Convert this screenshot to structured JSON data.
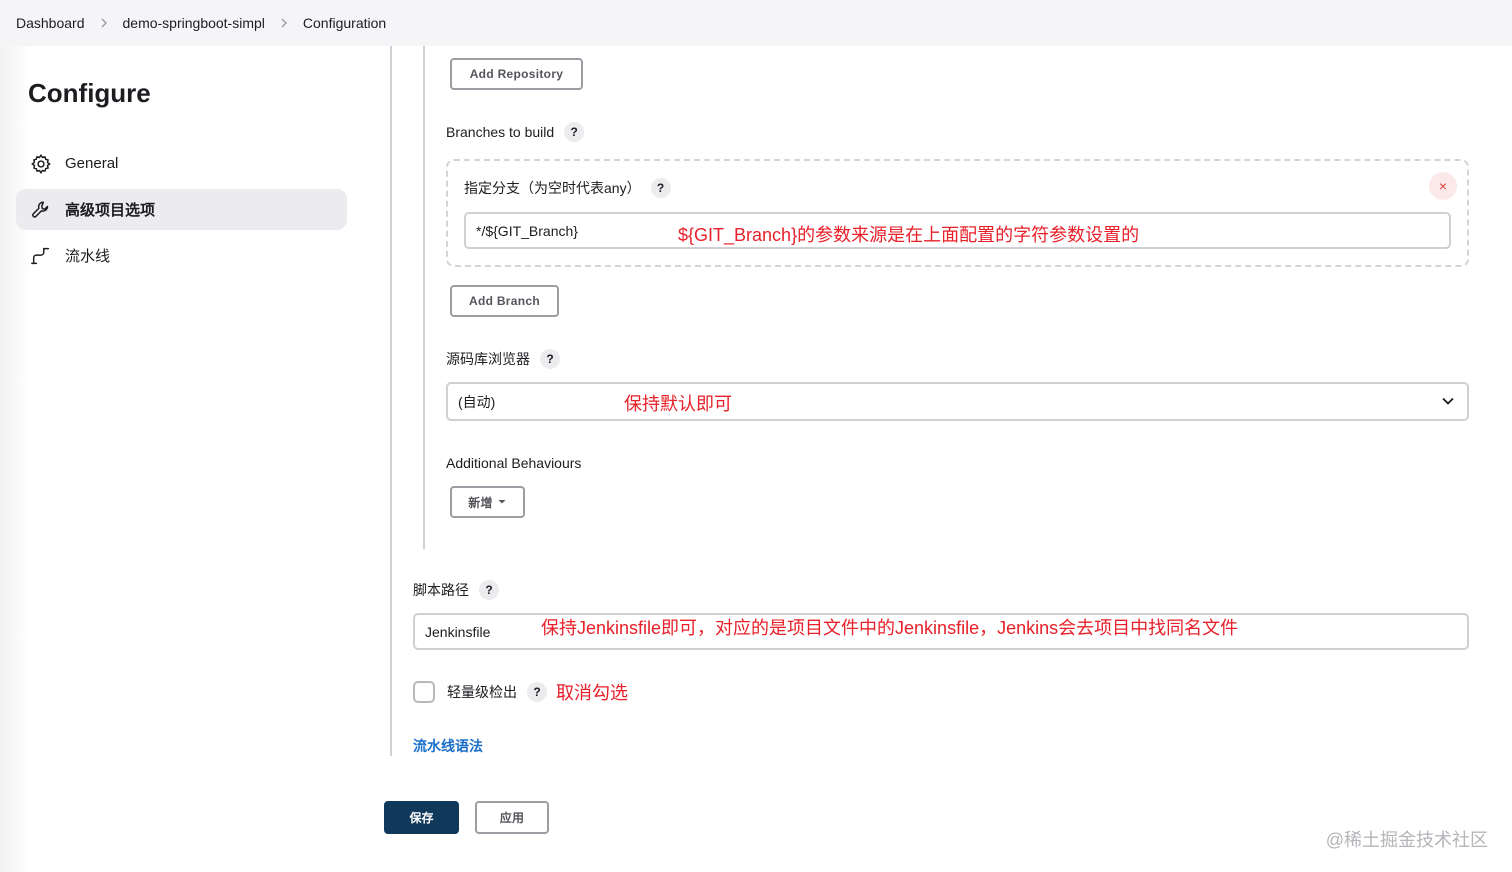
{
  "breadcrumb": {
    "items": [
      "Dashboard",
      "demo-springboot-simpl",
      "Configuration"
    ],
    "separator": ">"
  },
  "sidebar": {
    "title": "Configure",
    "items": [
      {
        "label": "General",
        "icon": "gear-icon",
        "active": false
      },
      {
        "label": "高级项目选项",
        "icon": "wrench-icon",
        "active": true
      },
      {
        "label": "流水线",
        "icon": "pipeline-icon",
        "active": false
      }
    ]
  },
  "scm": {
    "add_repository_label": "Add Repository",
    "branches_label": "Branches to build",
    "branch_spec_label": "指定分支（为空时代表any）",
    "branch_value": "*/${GIT_Branch}",
    "branch_annotation": "${GIT_Branch}的参数来源是在上面配置的字符参数设置的",
    "add_branch_label": "Add Branch",
    "browser_label": "源码库浏览器",
    "browser_value": "(自动)",
    "browser_annotation": "保持默认即可",
    "behaviours_label": "Additional Behaviours",
    "add_behaviour_label": "新增"
  },
  "script": {
    "path_label": "脚本路径",
    "path_value": "Jenkinsfile",
    "path_annotation": "保持Jenkinsfile即可，对应的是项目文件中的Jenkinsfile，Jenkins会去项目中找同名文件",
    "lightweight_label": "轻量级检出",
    "lightweight_checked": false,
    "lightweight_annotation": "取消勾选",
    "syntax_link": "流水线语法"
  },
  "help_symbol": "?",
  "close_symbol": "×",
  "actions": {
    "save_label": "保存",
    "apply_label": "应用"
  },
  "watermark": "@稀土掘金技术社区",
  "colors": {
    "primary": "#10385a",
    "link": "#1a6fc9",
    "annotation": "#e8202a"
  }
}
